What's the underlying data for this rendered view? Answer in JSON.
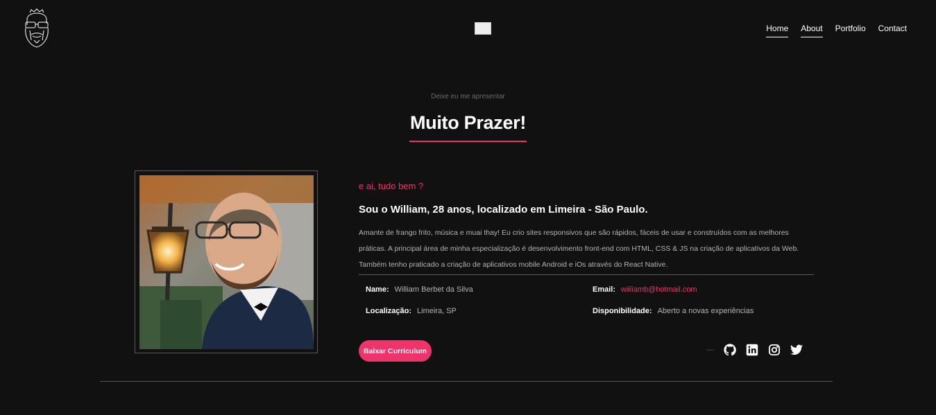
{
  "nav": {
    "items": [
      {
        "label": "Home"
      },
      {
        "label": "About"
      },
      {
        "label": "Portfolio"
      },
      {
        "label": "Contact"
      }
    ]
  },
  "about": {
    "eyebrow": "Deixe eu me apresentar",
    "title": "Muito Prazer!",
    "greeting": "e ai, tudo bem ?",
    "headline": "Sou o William, 28 anos, localizado em Limeira - São Paulo.",
    "description": "Amante de frango frito, música e muai thay! Eu crio sites responsivos que são rápidos, fáceis de usar e construídos com as melhores práticas. A principal área de minha especialização é desenvolvimento front-end com HTML, CSS & JS na criação de aplicativos da Web. Também tenho praticado a criação de aplicativos mobile Android e iOs através do React Native.",
    "info": {
      "name_label": "Name:",
      "name_value": "William Berbet da Silva",
      "email_label": "Email:",
      "email_value": "wiiliamb@hotmail.com",
      "location_label": "Localização:",
      "location_value": "Limeira, SP",
      "availability_label": "Disponibilidade:",
      "availability_value": "Aberto a novas experiências"
    },
    "download_button": "Baixar Curriculum",
    "social_dash": "—"
  },
  "icons": [
    "bearded-face-logo-icon",
    "github-icon",
    "linkedin-icon",
    "instagram-icon",
    "twitter-icon"
  ],
  "colors": {
    "background": "#111111",
    "accent": "#f0336b",
    "text": "#ffffff",
    "muted": "#b3b3b3"
  }
}
